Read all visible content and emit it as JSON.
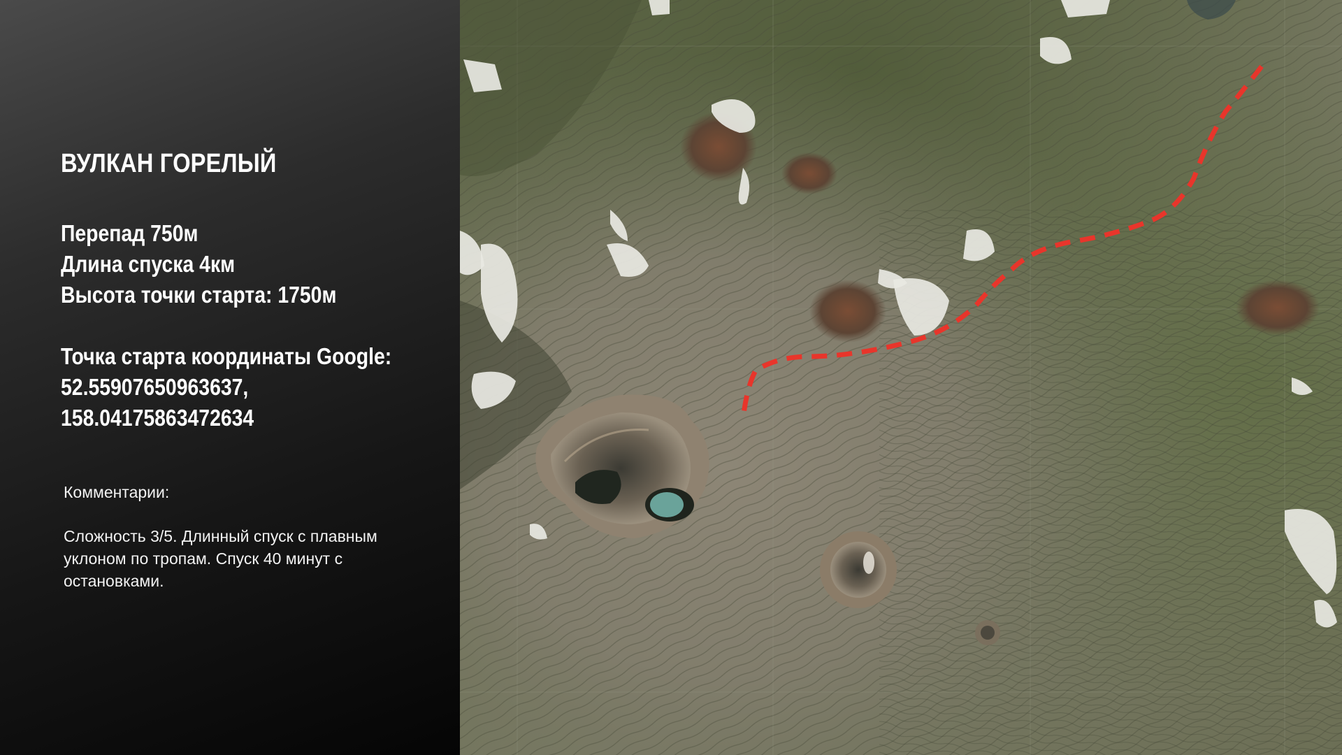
{
  "slide": {
    "title": "ВУЛКАН ГОРЕЛЫЙ",
    "stats": {
      "drop": "Перепад 750м",
      "length": "Длина спуска 4км",
      "start_altitude": "Высота точки старта: 1750м"
    },
    "coordinates": {
      "label": "Точка старта координаты Google:",
      "lat": "52.55907650963637,",
      "lon": "158.04175863472634"
    },
    "comments": {
      "label": "Комментарии:",
      "text": "Сложность 3/5. Длинный спуск с плавным уклоном по тропам. Спуск 40 минут с остановками."
    }
  },
  "map": {
    "type": "satellite-image",
    "route_color": "#e8352b",
    "route_style": "dashed"
  }
}
